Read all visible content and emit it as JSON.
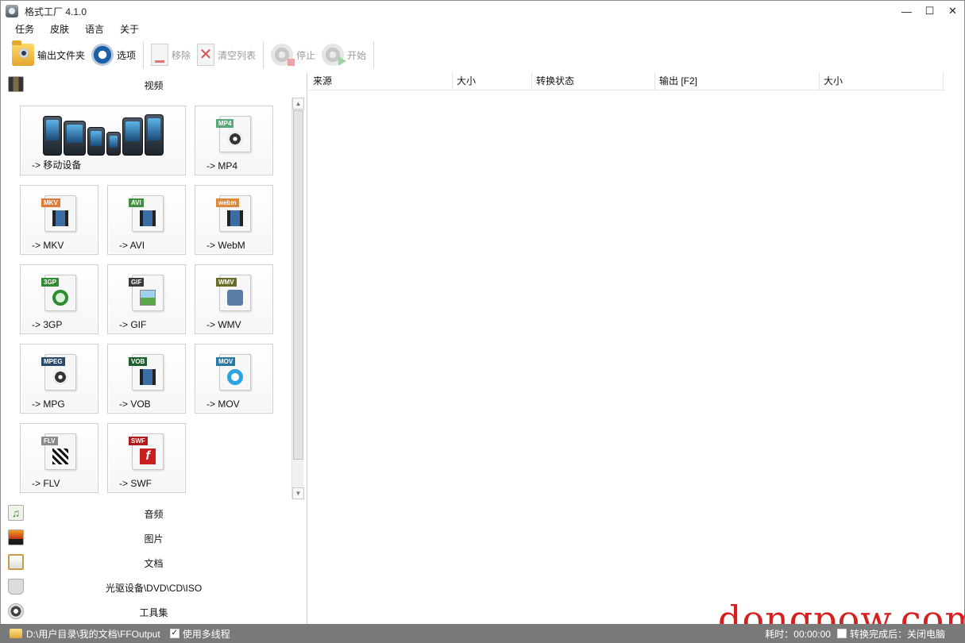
{
  "window": {
    "title": "格式工厂 4.1.0",
    "controls": {
      "minimize": "—",
      "maximize": "☐",
      "close": "✕"
    }
  },
  "menu": [
    "任务",
    "皮肤",
    "语言",
    "关于"
  ],
  "toolbar": {
    "output_folder": "输出文件夹",
    "options": "选项",
    "remove": "移除",
    "clear_list": "清空列表",
    "stop": "停止",
    "start": "开始"
  },
  "sidebar": {
    "video": "视频",
    "audio": "音频",
    "image": "图片",
    "document": "文档",
    "disc": "光驱设备\\DVD\\CD\\ISO",
    "tools": "工具集"
  },
  "tiles": [
    {
      "label": "-> 移动设备"
    },
    {
      "label": "-> MP4",
      "tag": "MP4",
      "tag_color": "#5aa77a"
    },
    {
      "label": "-> MKV",
      "tag": "MKV",
      "tag_color": "#e07a3a"
    },
    {
      "label": "-> AVI",
      "tag": "AVI",
      "tag_color": "#3f8f3f"
    },
    {
      "label": "-> WebM",
      "tag": "webm",
      "tag_color": "#d98a3a"
    },
    {
      "label": "-> 3GP",
      "tag": "3GP",
      "tag_color": "#2f8b2f"
    },
    {
      "label": "-> GIF",
      "tag": "GIF",
      "tag_color": "#3a3a3a"
    },
    {
      "label": "-> WMV",
      "tag": "WMV",
      "tag_color": "#6b6b2a"
    },
    {
      "label": "-> MPG",
      "tag": "MPEG",
      "tag_color": "#2a4a6b"
    },
    {
      "label": "-> VOB",
      "tag": "VOB",
      "tag_color": "#1f5e2f"
    },
    {
      "label": "-> MOV",
      "tag": "MOV",
      "tag_color": "#2a7aa8"
    },
    {
      "label": "-> FLV",
      "tag": "FLV",
      "tag_color": "#8a8a8a"
    },
    {
      "label": "-> SWF",
      "tag": "SWF",
      "tag_color": "#b01a1a"
    }
  ],
  "list_columns": [
    "来源",
    "大小",
    "转换状态",
    "输出 [F2]",
    "大小"
  ],
  "statusbar": {
    "output_path": "D:\\用户目录\\我的文档\\FFOutput",
    "multithread": "使用多线程",
    "elapsed": "耗时：00:00:00",
    "shutdown": "转换完成后：关闭电脑"
  },
  "watermark": "dongpow.com"
}
